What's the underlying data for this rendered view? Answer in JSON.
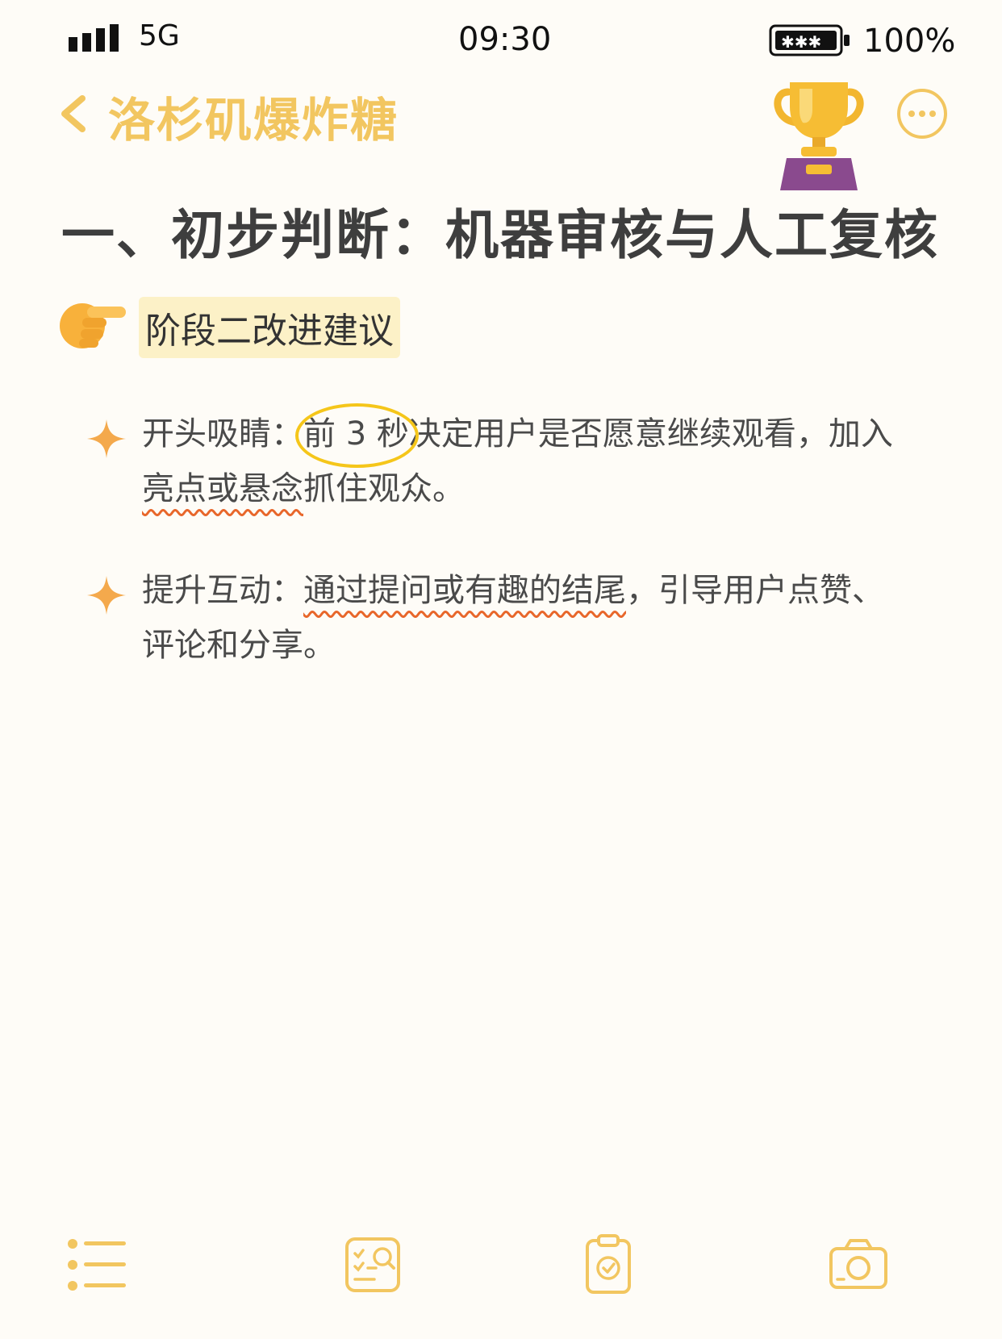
{
  "status": {
    "network": "5G",
    "time": "09:30",
    "battery": "100%"
  },
  "nav": {
    "title": "洛杉矶爆炸糖"
  },
  "heading": {
    "title": "一、初步判断：机器审核与人工复核"
  },
  "section": {
    "label": "阶段二改进建议"
  },
  "items": [
    {
      "lead": "开头吸睛：",
      "circled": "前 3 秒",
      "mid": "决定用户是否愿意继续观看，加入",
      "wavy": "亮点或悬念",
      "tail": "抓住观众。"
    },
    {
      "lead": "提升互动：",
      "wavy": "通过提问或有趣的结尾",
      "tail": "，引导用户点赞、评论和分享。"
    }
  ],
  "colors": {
    "accent": "#F2C660",
    "background": "#FEFCF7",
    "highlight": "#FCF1C7",
    "sparkle": "#F4A94C",
    "wavy": "#E8672B",
    "circle": "#F5C61A"
  },
  "icons": [
    "back-icon",
    "trophy-icon",
    "more-icon",
    "pointing-hand-icon",
    "sparkle-icon",
    "list-icon",
    "checklist-search-icon",
    "clipboard-check-icon",
    "camera-icon"
  ]
}
